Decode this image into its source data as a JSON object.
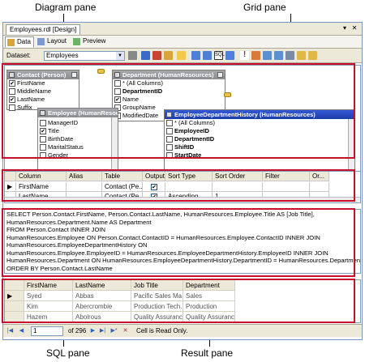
{
  "callouts": {
    "diagram_pane": "Diagram pane",
    "grid_pane": "Grid pane",
    "sql_pane": "SQL pane",
    "result_pane": "Result pane"
  },
  "window": {
    "doc_tab": "Employees.rdl [Design]"
  },
  "tabs": [
    {
      "label": "Data",
      "icon": "data-icon"
    },
    {
      "label": "Layout",
      "icon": "layout-icon"
    },
    {
      "label": "Preview",
      "icon": "preview-icon"
    }
  ],
  "toolbar": {
    "dataset_label": "Dataset:",
    "dataset_value": "Employees"
  },
  "diagram": {
    "contact": {
      "title": "Contact (Person)",
      "rows": [
        {
          "label": "FirstName",
          "checked": true
        },
        {
          "label": "MiddleName",
          "checked": false
        },
        {
          "label": "LastName",
          "checked": true
        },
        {
          "label": "Suffix",
          "checked": false
        }
      ]
    },
    "department": {
      "title": "Department (HumanResources)",
      "rows": [
        {
          "label": "* (All Columns)",
          "checked": false
        },
        {
          "label": "DepartmentID",
          "checked": false,
          "bold": true
        },
        {
          "label": "Name",
          "checked": true
        },
        {
          "label": "GroupName",
          "checked": false
        },
        {
          "label": "ModifiedDate",
          "checked": false
        }
      ]
    },
    "employee": {
      "title": "Employee (HumanResources)",
      "rows": [
        {
          "label": "ManagerID",
          "checked": false
        },
        {
          "label": "Title",
          "checked": true
        },
        {
          "label": "BirthDate",
          "checked": false
        },
        {
          "label": "MaritalStatus",
          "checked": false
        },
        {
          "label": "Gender",
          "checked": false
        }
      ]
    },
    "edh": {
      "title": "EmployeeDepartmentHistory (HumanResources)",
      "rows": [
        {
          "label": "* (All Columns)",
          "checked": false
        },
        {
          "label": "EmployeeID",
          "checked": false,
          "bold": true
        },
        {
          "label": "DepartmentID",
          "checked": false,
          "bold": true
        },
        {
          "label": "ShiftID",
          "checked": false,
          "bold": true
        },
        {
          "label": "StartDate",
          "checked": false,
          "bold": true
        }
      ]
    }
  },
  "grid": {
    "headers": [
      "Column",
      "Alias",
      "Table",
      "Output",
      "Sort Type",
      "Sort Order",
      "Filter",
      "Or..."
    ],
    "rows": [
      {
        "column": "FirstName",
        "alias": "",
        "table": "Contact (Pe...",
        "output": true,
        "sort_type": "",
        "sort_order": ""
      },
      {
        "column": "LastName",
        "alias": "",
        "table": "Contact (Pe...",
        "output": true,
        "sort_type": "Ascending",
        "sort_order": "1"
      }
    ]
  },
  "sql": {
    "lines": [
      "SELECT     Person.Contact.FirstName, Person.Contact.LastName, HumanResources.Employee.Title AS [Job Title],",
      "                  HumanResources.Department.Name AS Department",
      "FROM         Person.Contact INNER JOIN",
      "                  HumanResources.Employee ON Person.Contact.ContactID = HumanResources.Employee.ContactID INNER JOIN",
      "                  HumanResources.EmployeeDepartmentHistory ON",
      "                  HumanResources.Employee.EmployeeID = HumanResources.EmployeeDepartmentHistory.EmployeeID INNER JOIN",
      "                  HumanResources.Department ON HumanResources.EmployeeDepartmentHistory.DepartmentID = HumanResources.Department",
      "ORDER BY Person.Contact.LastName"
    ]
  },
  "result": {
    "headers": [
      "FirstName",
      "LastName",
      "Job Title",
      "Department"
    ],
    "rows": [
      [
        "Syed",
        "Abbas",
        "Pacific Sales Ma...",
        "Sales"
      ],
      [
        "Kim",
        "Abercrombie",
        "Production Tech...",
        "Production"
      ],
      [
        "Hazem",
        "Abolrous",
        "Quality Assuranc...",
        "Quality Assurance"
      ]
    ]
  },
  "status": {
    "page": "1",
    "of_total": "of 296",
    "message": "Cell is Read Only."
  }
}
